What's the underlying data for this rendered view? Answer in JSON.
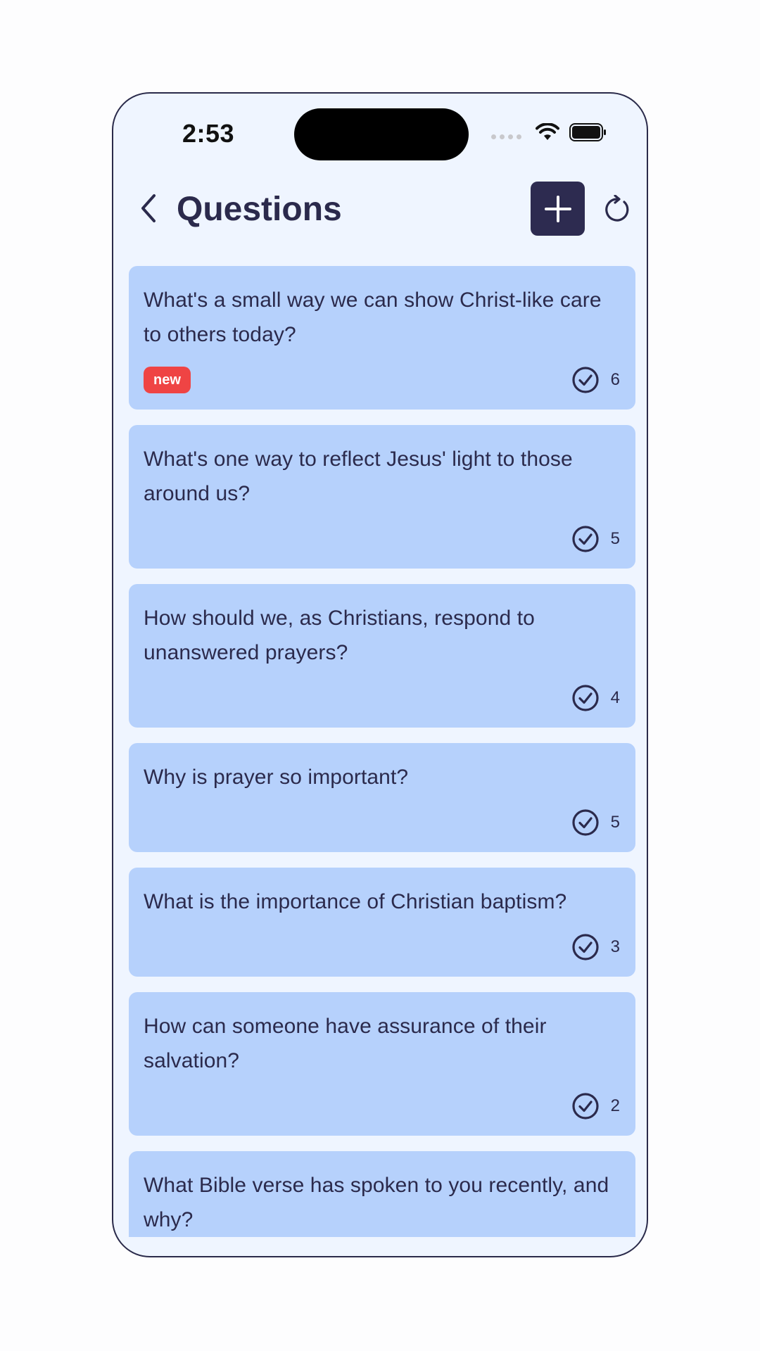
{
  "status_bar": {
    "time": "2:53"
  },
  "header": {
    "title": "Questions",
    "back_icon": "chevron-left-icon",
    "add_icon": "plus-icon",
    "refresh_icon": "refresh-icon"
  },
  "colors": {
    "background": "#eff5ff",
    "card": "#b6d1fc",
    "primary": "#2d2b50",
    "badge": "#ef4444"
  },
  "questions": [
    {
      "text": "What's a small way we can show Christ-like care to others today?",
      "badge": "new",
      "count": "6"
    },
    {
      "text": "What's one way to reflect Jesus' light to those around us?",
      "badge": "",
      "count": "5"
    },
    {
      "text": "How should we, as Christians, respond to unanswered prayers?",
      "badge": "",
      "count": "4"
    },
    {
      "text": "Why is prayer so important?",
      "badge": "",
      "count": "5"
    },
    {
      "text": "What is the importance of Christian baptism?",
      "badge": "",
      "count": "3"
    },
    {
      "text": "How can someone have assurance of their salvation?",
      "badge": "",
      "count": "2"
    },
    {
      "text": "What Bible verse has spoken to you recently, and why?",
      "badge": "",
      "count": ""
    }
  ]
}
